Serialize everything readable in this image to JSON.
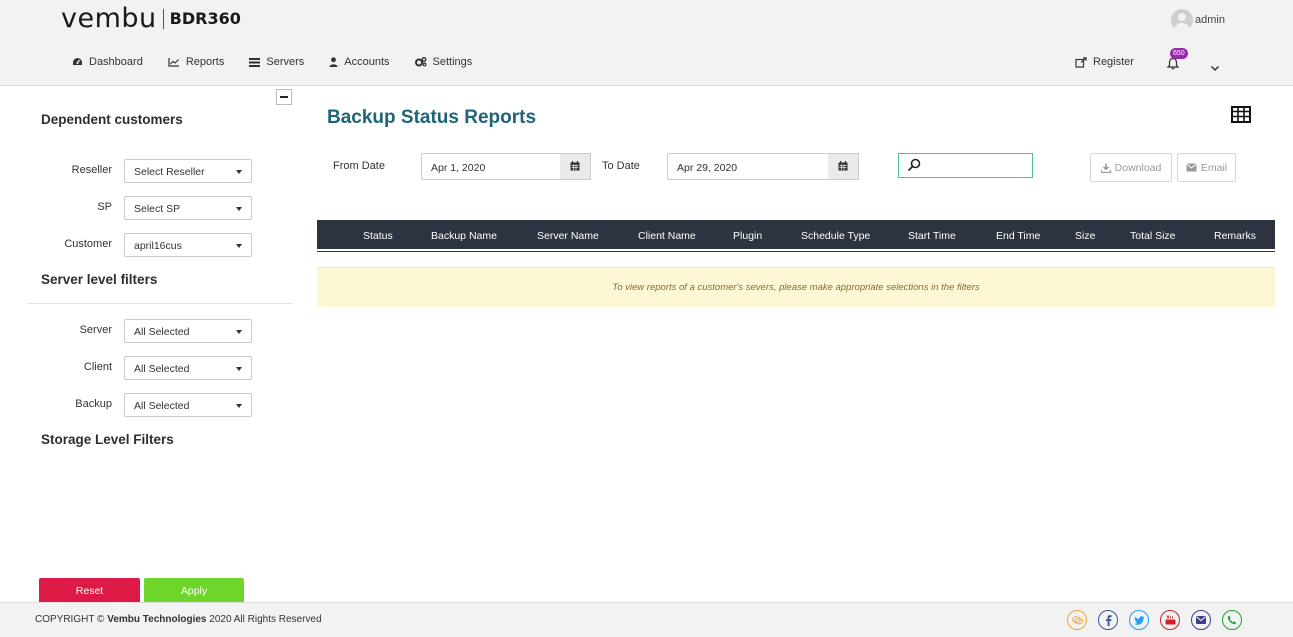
{
  "header": {
    "logo_text": "vembu",
    "logo_product": "BDR360",
    "user_name": "admin",
    "nav": [
      {
        "label": "Dashboard",
        "icon": "dashboard-icon"
      },
      {
        "label": "Reports",
        "icon": "line-chart-icon"
      },
      {
        "label": "Servers",
        "icon": "server-list-icon"
      },
      {
        "label": "Accounts",
        "icon": "user-icon"
      },
      {
        "label": "Settings",
        "icon": "gears-icon"
      }
    ],
    "register_label": "Register",
    "notification_count": "650"
  },
  "sidebar": {
    "dependent_heading": "Dependent customers",
    "server_heading": "Server level filters",
    "storage_heading": "Storage Level Filters",
    "filters": {
      "reseller": {
        "label": "Reseller",
        "value": "Select Reseller"
      },
      "sp": {
        "label": "SP",
        "value": "Select SP"
      },
      "customer": {
        "label": "Customer",
        "value": "april16cus"
      },
      "server": {
        "label": "Server",
        "value": "All Selected"
      },
      "client": {
        "label": "Client",
        "value": "All Selected"
      },
      "backup": {
        "label": "Backup",
        "value": "All Selected"
      }
    },
    "reset_label": "Reset",
    "apply_label": "Apply"
  },
  "main": {
    "title": "Backup Status Reports",
    "from_date_label": "From Date",
    "from_date_value": "Apr 1, 2020",
    "to_date_label": "To Date",
    "to_date_value": "Apr 29, 2020",
    "download_label": "Download",
    "email_label": "Email",
    "columns": [
      "Status",
      "Backup Name",
      "Server Name",
      "Client Name",
      "Plugin",
      "Schedule Type",
      "Start Time",
      "End Time",
      "Size",
      "Total Size",
      "Remarks"
    ],
    "notice": "To view reports of a customer's severs, please make appropriate selections in the filters"
  },
  "footer": {
    "copyright_prefix": "COPYRIGHT ©",
    "brand": "Vembu Technologies",
    "copyright_suffix": "2020 All Rights Reserved",
    "social": [
      {
        "name": "chat-icon",
        "color": "#f0a830"
      },
      {
        "name": "facebook-icon",
        "color": "#3b5998"
      },
      {
        "name": "twitter-icon",
        "color": "#1da1f2"
      },
      {
        "name": "youtube-icon",
        "color": "#d0202a"
      },
      {
        "name": "email-icon",
        "color": "#3d3f8f"
      },
      {
        "name": "phone-icon",
        "color": "#1e9e2e"
      }
    ]
  },
  "colors": {
    "title": "#1f6478",
    "table_header": "#2c3441",
    "reset": "#dc1a45",
    "apply": "#6ed62a",
    "badge": "#9b27af",
    "notice_bg": "#fcf8d6"
  }
}
